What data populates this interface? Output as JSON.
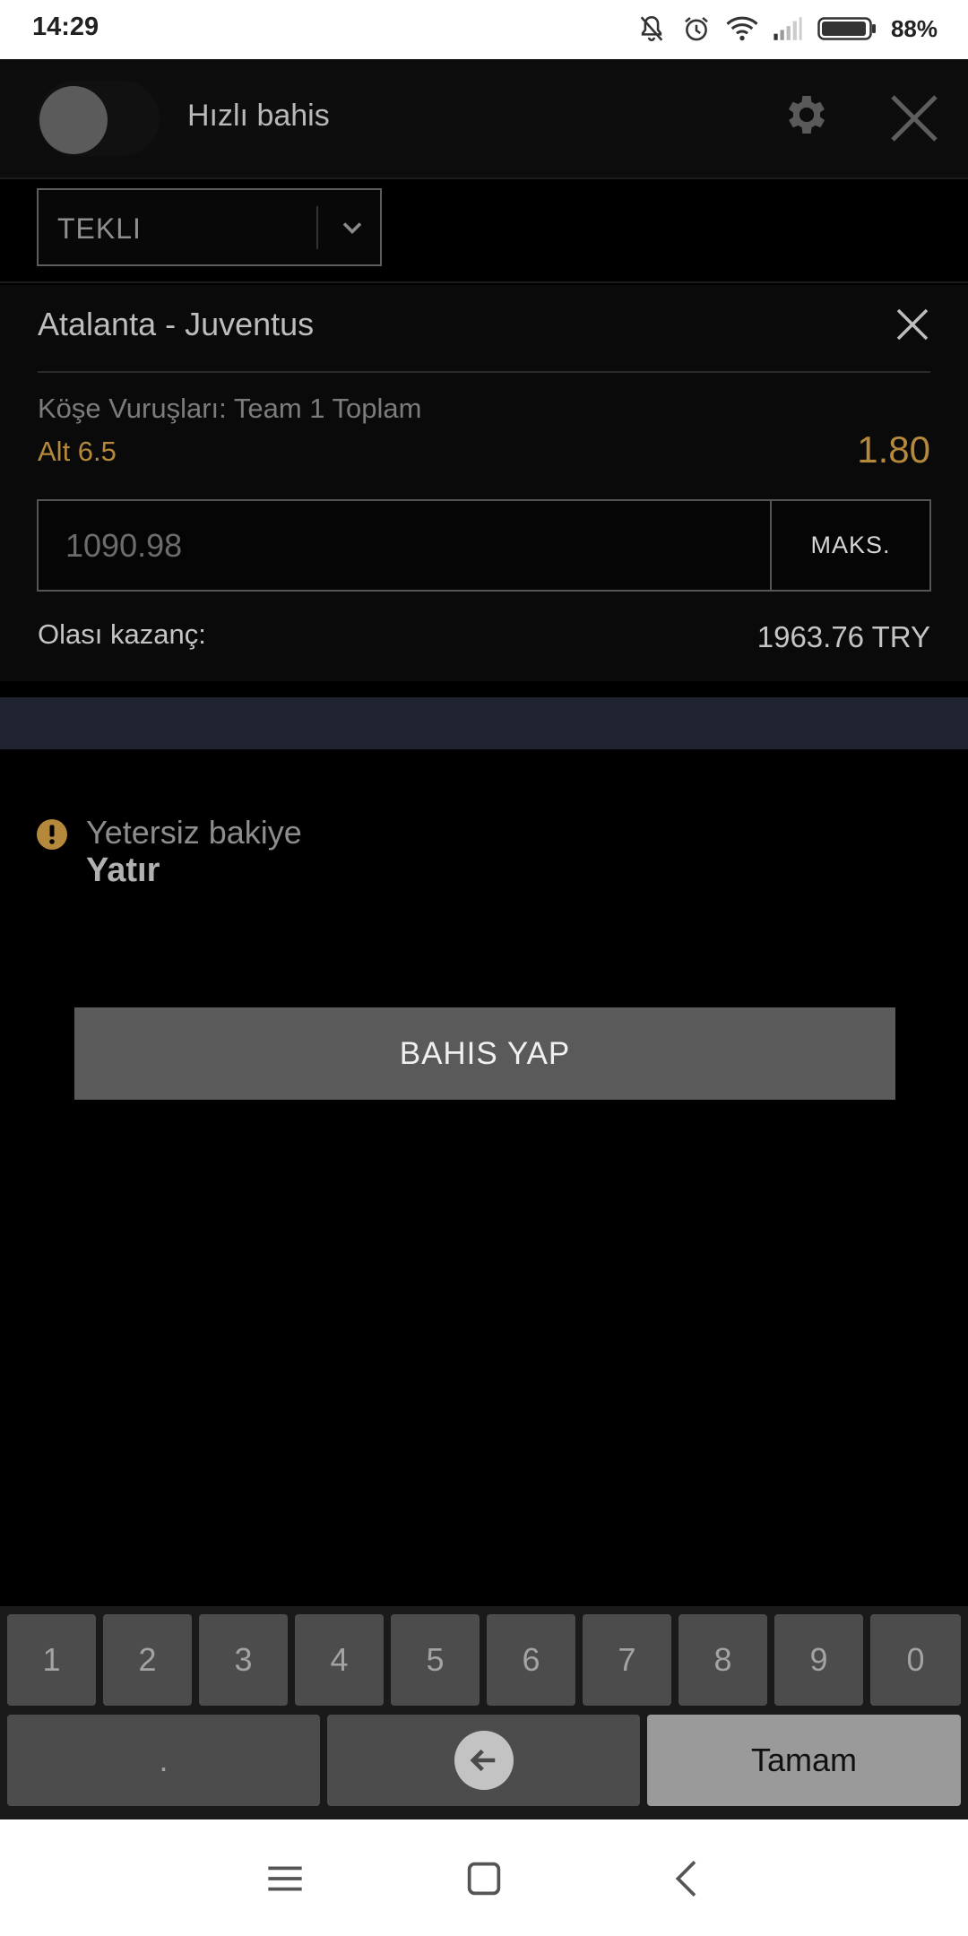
{
  "status_bar": {
    "time": "14:29",
    "battery": "88%",
    "icons": [
      "muted-bell-icon",
      "alarm-icon",
      "wifi-icon",
      "signal-icon",
      "battery-icon"
    ]
  },
  "header": {
    "quick_bet_label": "Hızlı bahis",
    "quick_bet_on": false
  },
  "bet_type": {
    "selected": "TEKLI"
  },
  "event": {
    "title": "Atalanta - Juventus",
    "market": "Köşe Vuruşları: Team 1 Toplam",
    "selection": "Alt 6.5",
    "odds": "1.80",
    "stake_placeholder": "1090.98",
    "max_label": "MAKS.",
    "winnings_label": "Olası kazanç:",
    "winnings_value": "1963.76 TRY"
  },
  "warning": {
    "message": "Yetersiz bakiye",
    "link": "Yatır"
  },
  "place_bet_label": "BAHIS YAP",
  "keypad": {
    "digits": [
      "1",
      "2",
      "3",
      "4",
      "5",
      "6",
      "7",
      "8",
      "9",
      "0"
    ],
    "dot": ".",
    "done": "Tamam"
  },
  "colors": {
    "accent": "#b5893b",
    "background": "#000000",
    "info_band": "#1f2330"
  }
}
